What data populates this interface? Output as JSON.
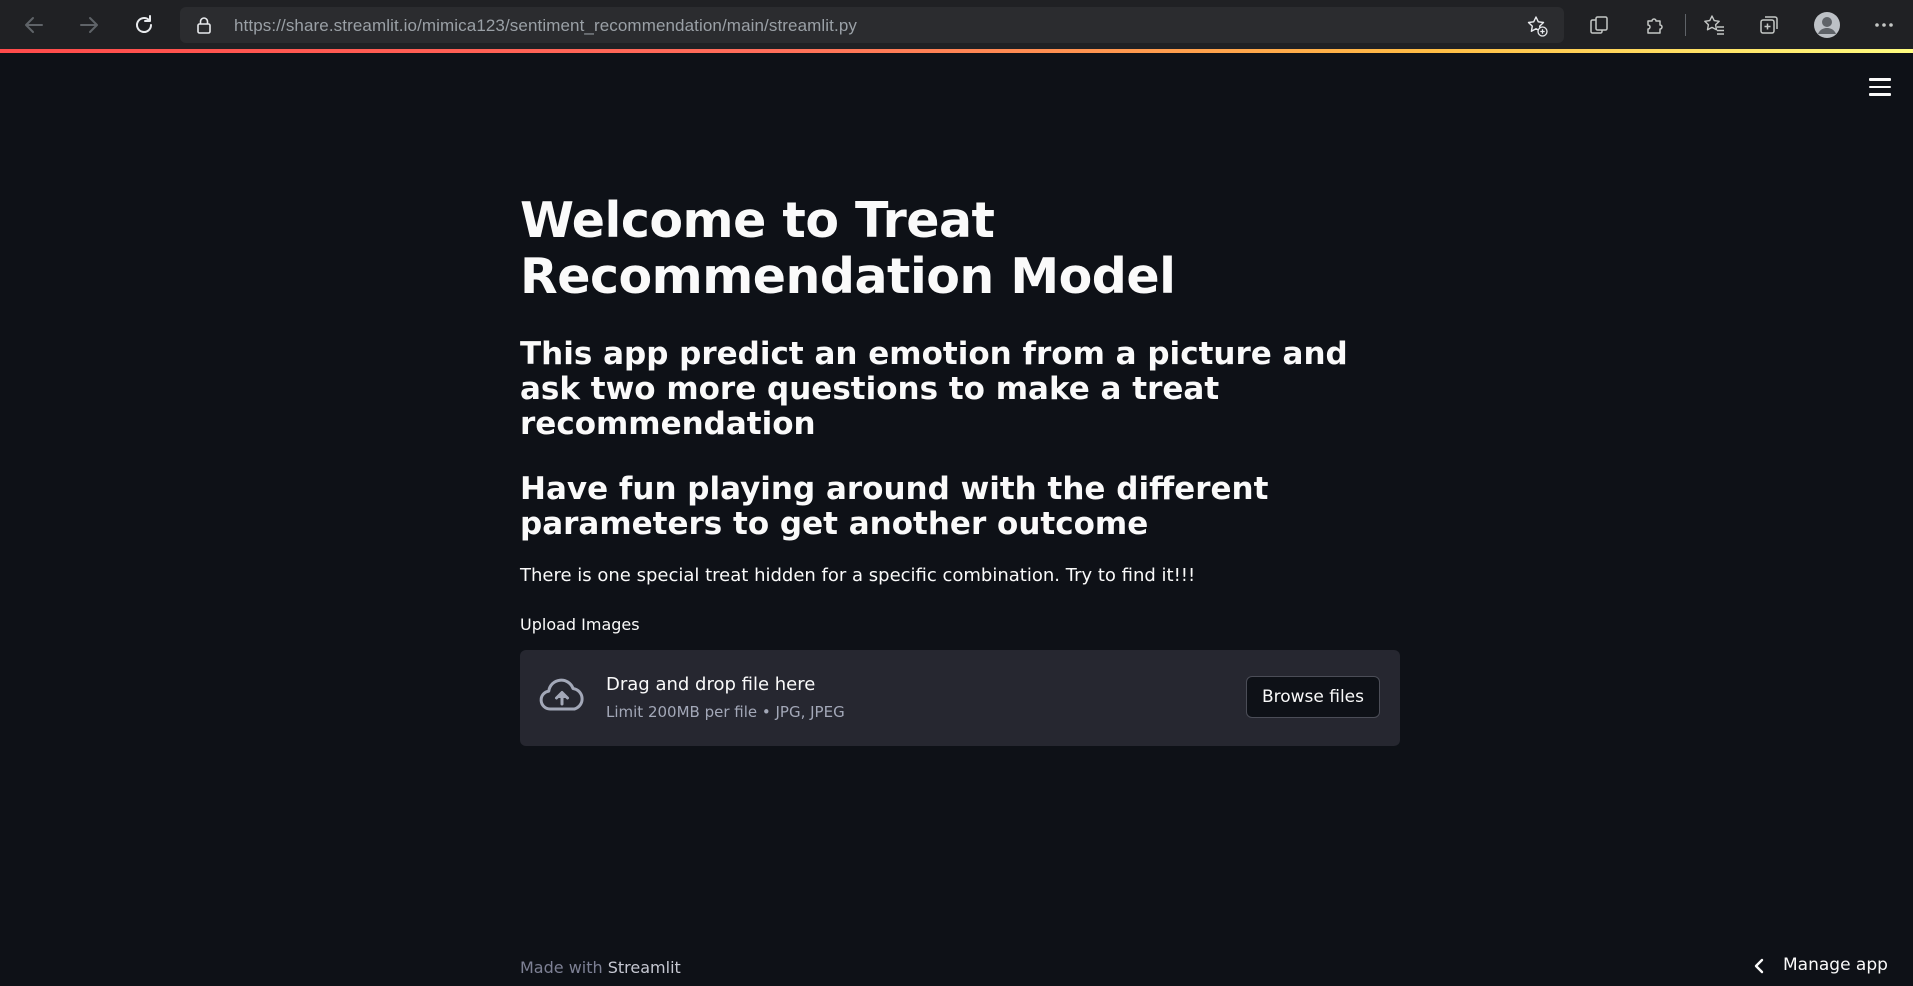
{
  "browser": {
    "url_host": "https://share.streamlit.io",
    "url_path": "/mimica123/sentiment_recommendation/main/streamlit.py",
    "icons": {
      "back": "back-arrow-icon",
      "forward": "forward-arrow-icon",
      "reload": "reload-icon",
      "lock": "lock-icon",
      "favorite_add": "star-plus-icon",
      "collections": "tab-actions-icon",
      "extensions": "puzzle-icon",
      "favorites": "favorites-icon",
      "collections_menu": "collections-icon",
      "profile": "profile-avatar-icon",
      "more": "more-dots-icon"
    }
  },
  "app": {
    "title": "Welcome to Treat Recommendation Model",
    "subtitle_1": "This app predict an emotion from a picture and ask two more questions to make a treat recommendation",
    "subtitle_2": "Have fun playing around with the different parameters to get another outcome",
    "body": "There is one special treat hidden for a specific combination. Try to find it!!!",
    "uploader": {
      "label": "Upload Images",
      "drag_text": "Drag and drop file here",
      "limit_text": "Limit 200MB per file • JPG, JPEG",
      "button_label": "Browse files",
      "icon": "cloud-upload-icon"
    },
    "footer": {
      "prefix": "Made with",
      "brand": "Streamlit"
    },
    "manage_app": "Manage app"
  },
  "colors": {
    "background": "#0e1117",
    "text": "#fafafa",
    "dropzone": "#262730",
    "accent": "#ff4b4b"
  }
}
